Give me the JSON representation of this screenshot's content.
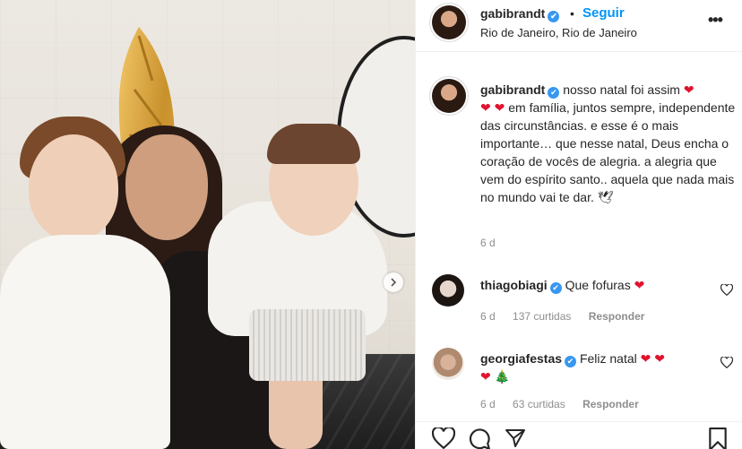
{
  "post_header": {
    "username": "gabibrandt",
    "verified_glyph": "✔",
    "dot": "•",
    "follow_label": "Seguir",
    "location": "Rio de Janeiro, Rio de Janeiro",
    "more_label": "•••"
  },
  "caption": {
    "username": "gabibrandt",
    "text_line1": "nosso natal foi assim",
    "text_rest": "em família, juntos sempre, independente das circunstâncias. e esse é o mais importante… que nesse natal, Deus encha o coração de vocês de alegria. a alegria que vem do espírito santo.. aquela que nada mais no mundo vai te dar. 🕊",
    "hearts_inline": "❤",
    "hearts_second": "❤ ❤",
    "time": "6 d"
  },
  "comments": [
    {
      "username": "thiagobiagi",
      "text": "Que fofuras",
      "emoji": "❤",
      "time": "6 d",
      "likes": "137 curtidas",
      "reply_label": "Responder"
    },
    {
      "username": "georgiafestas",
      "text": "Feliz natal",
      "emoji": "❤ ❤",
      "emoji_second": "❤ 🎄",
      "time": "6 d",
      "likes": "63 curtidas",
      "reply_label": "Responder"
    }
  ],
  "icons": {
    "like": "heart-outline-icon",
    "comment": "comment-icon",
    "share": "paper-plane-icon",
    "save": "bookmark-icon",
    "carousel_next": "chevron-right-icon"
  },
  "colors": {
    "accent": "#0095f6",
    "verified": "#3897f0",
    "heart": "#e0142f",
    "muted": "#8e8e8e"
  }
}
